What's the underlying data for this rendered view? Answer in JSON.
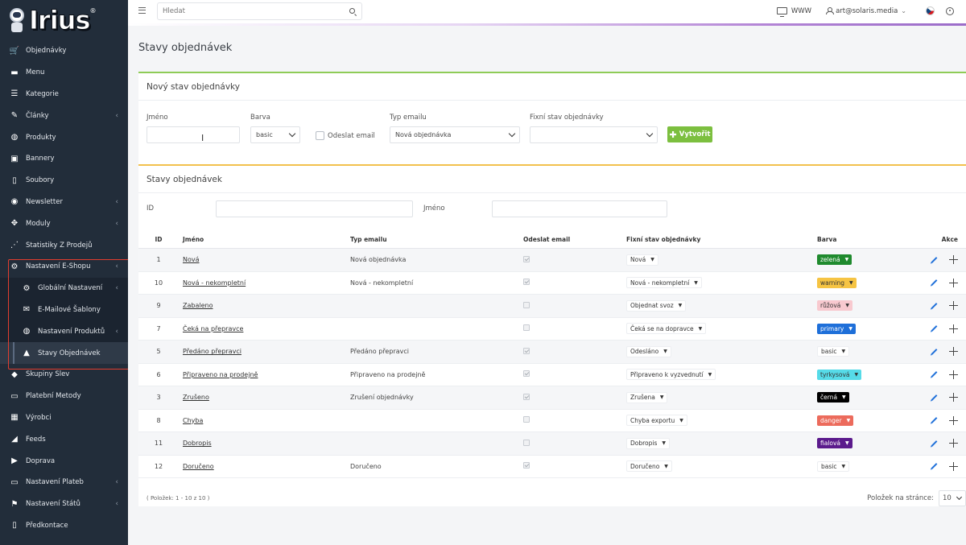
{
  "brand": {
    "logo_text": "Irius",
    "reg": "®"
  },
  "sidebar": {
    "items": [
      {
        "label": "Objednávky",
        "icon": "cart-icon",
        "arrow": false
      },
      {
        "label": "Menu",
        "icon": "folder-icon",
        "arrow": false
      },
      {
        "label": "Kategorie",
        "icon": "list-icon",
        "arrow": false
      },
      {
        "label": "Články",
        "icon": "pencil-icon",
        "arrow": true
      },
      {
        "label": "Produkty",
        "icon": "globe-icon",
        "arrow": false
      },
      {
        "label": "Bannery",
        "icon": "image-icon",
        "arrow": false
      },
      {
        "label": "Soubory",
        "icon": "file-icon",
        "arrow": false
      },
      {
        "label": "Newsletter",
        "icon": "newsletter-icon",
        "arrow": true
      },
      {
        "label": "Moduly",
        "icon": "puzzle-icon",
        "arrow": true
      },
      {
        "label": "Statistiky Z Prodejů",
        "icon": "chart-icon",
        "arrow": false
      },
      {
        "label": "Nastavení E-Shopu",
        "icon": "settings-cog-icon",
        "arrow": true
      },
      {
        "label": "Globální Nastavení",
        "icon": "gear-icon",
        "arrow": true,
        "sub": true
      },
      {
        "label": "E-Mailové Šablony",
        "icon": "envelope-icon",
        "arrow": false,
        "sub": true
      },
      {
        "label": "Nastavení Produktů",
        "icon": "globe-icon",
        "arrow": true,
        "sub": true
      },
      {
        "label": "Stavy Objednávek",
        "icon": "bell-icon",
        "arrow": false,
        "sub": true,
        "active": true
      },
      {
        "label": "Skupiny Slev",
        "icon": "tag-icon",
        "arrow": false
      },
      {
        "label": "Platební Metody",
        "icon": "card-icon",
        "arrow": false
      },
      {
        "label": "Výrobci",
        "icon": "building-icon",
        "arrow": false
      },
      {
        "label": "Feeds",
        "icon": "rss-icon",
        "arrow": false
      },
      {
        "label": "Doprava",
        "icon": "truck-icon",
        "arrow": false
      },
      {
        "label": "Nastavení Plateb",
        "icon": "card-icon",
        "arrow": true
      },
      {
        "label": "Nastavení Států",
        "icon": "flag-icon",
        "arrow": true
      },
      {
        "label": "Předkontace",
        "icon": "file-icon",
        "arrow": false
      }
    ]
  },
  "topbar": {
    "search_placeholder": "Hledat",
    "www_label": "WWW",
    "user_email": "art@solaris.media"
  },
  "page": {
    "title": "Stavy objednávek"
  },
  "new_form": {
    "header": "Nový stav objednávky",
    "name_label": "Jméno",
    "color_label": "Barva",
    "color_value": "basic",
    "send_email_label": "Odeslat email",
    "email_type_label": "Typ emailu",
    "email_type_value": "Nová objednávka",
    "fixed_state_label": "Fixní stav objednávky",
    "fixed_state_value": "",
    "create_label": "Vytvořit"
  },
  "list": {
    "header": "Stavy objednávek",
    "filter_id_label": "ID",
    "filter_name_label": "Jméno",
    "columns": {
      "id": "ID",
      "name": "Jméno",
      "email_type": "Typ emailu",
      "send_email": "Odeslat email",
      "fixed_state": "Fixní stav objednávky",
      "color": "Barva",
      "actions": "Akce"
    },
    "rows": [
      {
        "id": "1",
        "name": "Nová",
        "email_type": "Nová objednávka",
        "send": true,
        "fixed": "Nová",
        "color": "zelená",
        "bg": "#1f8a2e",
        "fg": "#ffffff"
      },
      {
        "id": "10",
        "name": "Nová - nekompletní",
        "email_type": "Nová - nekompletní",
        "send": true,
        "fixed": "Nová - nekompletní",
        "color": "warning",
        "bg": "#f6c443",
        "fg": "#333333"
      },
      {
        "id": "9",
        "name": "Zabaleno",
        "email_type": "",
        "send": false,
        "fixed": "Objednat svoz",
        "color": "růžová",
        "bg": "#f8c9cf",
        "fg": "#333333"
      },
      {
        "id": "7",
        "name": "Čeká na přepravce",
        "email_type": "",
        "send": false,
        "fixed": "Čeká se na dopravce",
        "color": "primary",
        "bg": "#1e6fd9",
        "fg": "#ffffff"
      },
      {
        "id": "5",
        "name": "Předáno přepravci",
        "email_type": "Předáno přepravci",
        "send": true,
        "fixed": "Odesláno",
        "color": "basic",
        "bg": "#ffffff",
        "fg": "#333333"
      },
      {
        "id": "6",
        "name": "Připraveno na prodejně",
        "email_type": "Připraveno na prodejně",
        "send": true,
        "fixed": "Připraveno k vyzvednutí",
        "color": "tyrkysová",
        "bg": "#56dbe8",
        "fg": "#333333"
      },
      {
        "id": "3",
        "name": "Zrušeno",
        "email_type": "Zrušení objednávky",
        "send": true,
        "fixed": "Zrušena",
        "color": "černá",
        "bg": "#000000",
        "fg": "#ffffff"
      },
      {
        "id": "8",
        "name": "Chyba",
        "email_type": "",
        "send": false,
        "fixed": "Chyba exportu",
        "color": "danger",
        "bg": "#ec6b5c",
        "fg": "#ffffff"
      },
      {
        "id": "11",
        "name": "Dobropis",
        "email_type": "",
        "send": false,
        "fixed": "Dobropis",
        "color": "fialová",
        "bg": "#5b1a8c",
        "fg": "#ffffff"
      },
      {
        "id": "12",
        "name": "Doručeno",
        "email_type": "Doručeno",
        "send": true,
        "fixed": "Doručeno",
        "color": "basic",
        "bg": "#ffffff",
        "fg": "#333333"
      }
    ],
    "footer_count": "( Položek: 1 - 10 z 10 )",
    "per_page_label": "Položek na stránce:",
    "per_page_value": "10"
  }
}
